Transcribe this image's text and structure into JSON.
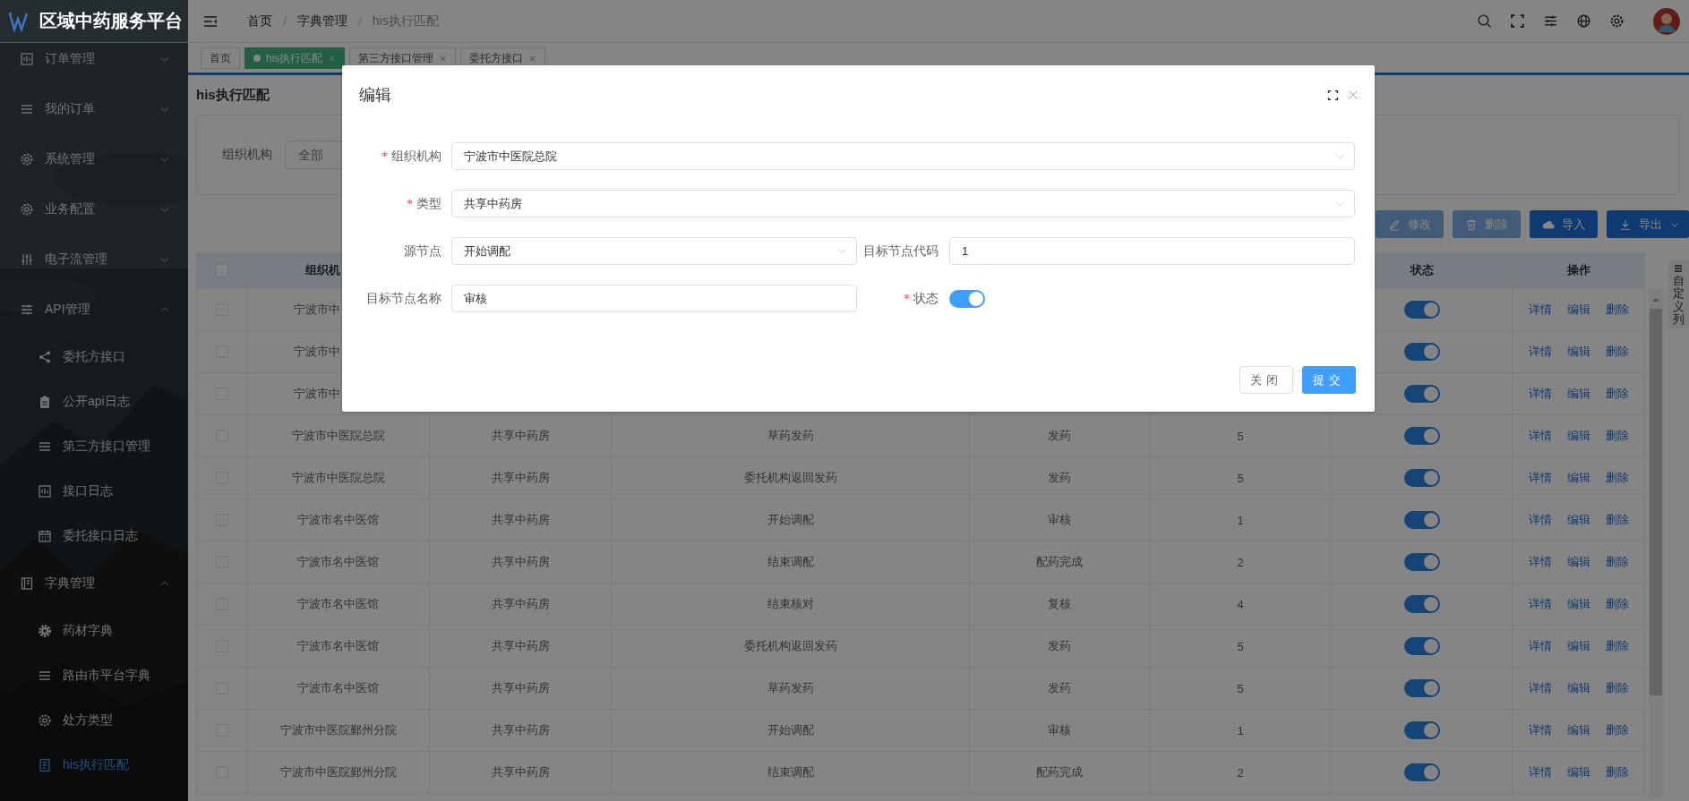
{
  "app": {
    "title": "区域中药服务平台"
  },
  "sidebar": {
    "items": [
      {
        "label": "订单管理",
        "expanded": false
      },
      {
        "label": "我的订单",
        "expanded": false
      },
      {
        "label": "系统管理",
        "expanded": false
      },
      {
        "label": "业务配置",
        "expanded": false
      },
      {
        "label": "电子流管理",
        "expanded": false
      },
      {
        "label": "API管理",
        "expanded": true,
        "children": [
          {
            "label": "委托方接口",
            "selected": false
          },
          {
            "label": "公开api日志",
            "selected": false
          },
          {
            "label": "第三方接口管理",
            "selected": false
          },
          {
            "label": "接口日志",
            "selected": false
          },
          {
            "label": "委托接口日志",
            "selected": false
          }
        ]
      },
      {
        "label": "字典管理",
        "expanded": true,
        "children": [
          {
            "label": "药材字典",
            "selected": false
          },
          {
            "label": "路由市平台字典",
            "selected": false
          },
          {
            "label": "处方类型",
            "selected": false
          },
          {
            "label": "his执行匹配",
            "selected": true
          }
        ]
      }
    ]
  },
  "breadcrumb": [
    {
      "kind": "link",
      "text": "首页"
    },
    {
      "kind": "separator",
      "text": "/"
    },
    {
      "kind": "link",
      "text": "字典管理"
    },
    {
      "kind": "separator",
      "text": "/"
    },
    {
      "kind": "current",
      "text": "his执行匹配"
    }
  ],
  "tabs": [
    {
      "label": "首页",
      "selected": false,
      "closable": false
    },
    {
      "label": "his执行匹配",
      "selected": true,
      "closable": true
    },
    {
      "label": "第三方接口管理",
      "selected": false,
      "closable": true
    },
    {
      "label": "委托方接口",
      "selected": false,
      "closable": true
    }
  ],
  "page_title": "his执行匹配",
  "filter": {
    "label": "组织机构",
    "placeholder": "全部"
  },
  "toolbar": [
    {
      "label": "修改",
      "disabled": true
    },
    {
      "label": "删除",
      "disabled": true
    },
    {
      "label": "导入",
      "disabled": false
    },
    {
      "label": "导出",
      "disabled": false
    }
  ],
  "table": {
    "select_all": {
      "checked": false
    },
    "columns": [
      {
        "label": "组织机"
      },
      {},
      {},
      {},
      {},
      {
        "label": "状态"
      },
      {
        "label": "操作"
      }
    ],
    "rows": [
      {
        "checked": false,
        "org": "宁波市中",
        "enabled": true,
        "actions": [
          "详情",
          "编辑",
          "删除"
        ]
      },
      {
        "checked": false,
        "org": "宁波市中",
        "enabled": true,
        "actions": [
          "详情",
          "编辑",
          "删除"
        ]
      },
      {
        "checked": false,
        "org": "宁波市中",
        "enabled": true,
        "actions": [
          "详情",
          "编辑",
          "删除"
        ]
      },
      {
        "checked": false,
        "org": "宁波市中医院总院",
        "type": "共享中药房",
        "source_node": "草药发药",
        "target_name": "发药",
        "target_code": "5",
        "enabled": true,
        "actions": [
          "详情",
          "编辑",
          "删除"
        ]
      },
      {
        "checked": false,
        "org": "宁波市中医院总院",
        "type": "共享中药房",
        "source_node": "委托机构返回发药",
        "target_name": "发药",
        "target_code": "5",
        "enabled": true,
        "actions": [
          "详情",
          "编辑",
          "删除"
        ]
      },
      {
        "checked": false,
        "org": "宁波市名中医馆",
        "type": "共享中药房",
        "source_node": "开始调配",
        "target_name": "审核",
        "target_code": "1",
        "enabled": true,
        "actions": [
          "详情",
          "编辑",
          "删除"
        ]
      },
      {
        "checked": false,
        "org": "宁波市名中医馆",
        "type": "共享中药房",
        "source_node": "结束调配",
        "target_name": "配药完成",
        "target_code": "2",
        "enabled": true,
        "actions": [
          "详情",
          "编辑",
          "删除"
        ]
      },
      {
        "checked": false,
        "org": "宁波市名中医馆",
        "type": "共享中药房",
        "source_node": "结束核对",
        "target_name": "复核",
        "target_code": "4",
        "enabled": true,
        "actions": [
          "详情",
          "编辑",
          "删除"
        ]
      },
      {
        "checked": false,
        "org": "宁波市名中医馆",
        "type": "共享中药房",
        "source_node": "委托机构返回发药",
        "target_name": "发药",
        "target_code": "5",
        "enabled": true,
        "actions": [
          "详情",
          "编辑",
          "删除"
        ]
      },
      {
        "checked": false,
        "org": "宁波市名中医馆",
        "type": "共享中药房",
        "source_node": "草药发药",
        "target_name": "发药",
        "target_code": "5",
        "enabled": true,
        "actions": [
          "详情",
          "编辑",
          "删除"
        ]
      },
      {
        "checked": false,
        "org": "宁波市中医院鄞州分院",
        "type": "共享中药房",
        "source_node": "开始调配",
        "target_name": "审核",
        "target_code": "1",
        "enabled": true,
        "actions": [
          "详情",
          "编辑",
          "删除"
        ]
      },
      {
        "checked": false,
        "org": "宁波市中医院鄞州分院",
        "type": "共享中药房",
        "source_node": "结束调配",
        "target_name": "配药完成",
        "target_code": "2",
        "enabled": true,
        "actions": [
          "详情",
          "编辑",
          "删除"
        ]
      }
    ]
  },
  "custom_columns": {
    "label": "自定义列"
  },
  "modal": {
    "title": "编辑",
    "rows": [
      [
        {
          "label": "组织机构",
          "required": true,
          "kind": "select",
          "value": "宁波市中医院总院"
        }
      ],
      [
        {
          "label": "类型",
          "required": true,
          "kind": "select",
          "value": "共享中药房"
        }
      ],
      [
        {
          "label": "源节点",
          "required": false,
          "kind": "select",
          "value": "开始调配"
        },
        {
          "label": "目标节点代码",
          "required": false,
          "kind": "input",
          "value": "1"
        }
      ],
      [
        {
          "label": "目标节点名称",
          "required": false,
          "kind": "input",
          "value": "审核"
        },
        {
          "label": "状态",
          "required": true,
          "kind": "switch",
          "on": true
        }
      ]
    ],
    "buttons": [
      {
        "label": "关闭",
        "primary": false
      },
      {
        "label": "提交",
        "primary": true
      }
    ]
  }
}
